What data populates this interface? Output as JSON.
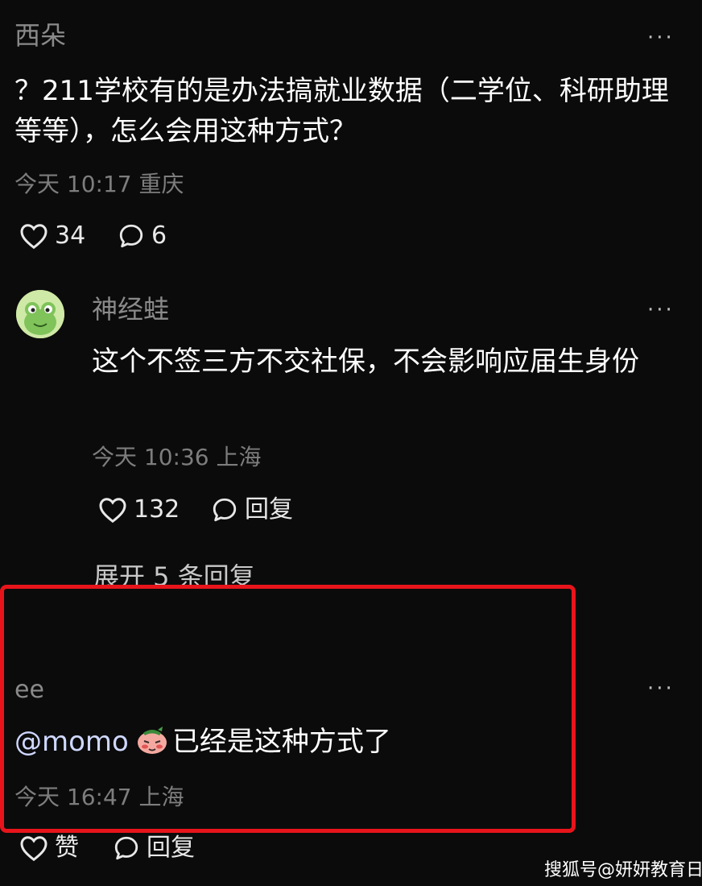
{
  "comments": [
    {
      "username": "西朵",
      "text": "？211学校有的是办法搞就业数据（二学位、科研助理等等），怎么会用这种方式？",
      "time": "今天 10:17",
      "location": "重庆",
      "likes": "34",
      "replies": "6",
      "more_label": "···"
    },
    {
      "username": "神经蛙",
      "avatar_icon": "frog-avatar-icon",
      "text": "这个不签三方不交社保，不会影响应届生身份",
      "time": "今天 10:36",
      "location": "上海",
      "likes": "132",
      "reply_label": "回复",
      "expand_label": "展开 5 条回复",
      "more_label": "···"
    },
    {
      "username": "ee",
      "mention": "@momo",
      "emoji_icon": "shy-face-emoji-icon",
      "text": "已经是这种方式了",
      "time": "今天 16:47",
      "location": "上海",
      "like_label": "赞",
      "reply_label": "回复",
      "more_label": "···"
    }
  ],
  "watermark": "搜狐号@妍妍教育日记",
  "colors": {
    "background": "#0b0b0b",
    "highlight_border": "#e8141b",
    "muted_text": "#7d7d7d"
  }
}
